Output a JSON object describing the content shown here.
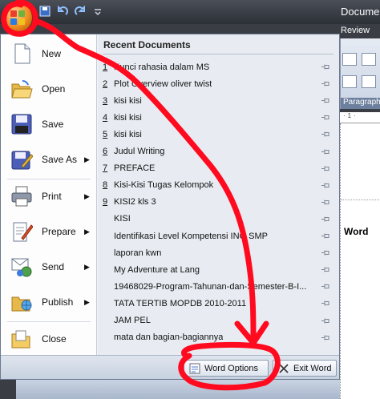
{
  "window": {
    "title": "Docume"
  },
  "ribbon": {
    "tab": "Review",
    "group": "Paragraph",
    "ruler": "·1·"
  },
  "document": {
    "visible_text": "Word"
  },
  "quick_access": [
    {
      "icon": "save-icon"
    },
    {
      "icon": "undo-icon"
    },
    {
      "icon": "redo-icon"
    },
    {
      "icon": "customize-icon"
    }
  ],
  "commands": [
    {
      "label": "New",
      "icon": "new-document-icon",
      "submenu": false
    },
    {
      "label": "Open",
      "icon": "open-folder-icon",
      "submenu": false
    },
    {
      "label": "Save",
      "icon": "save-disk-icon",
      "submenu": false
    },
    {
      "label": "Save As",
      "icon": "save-as-icon",
      "submenu": true
    },
    {
      "label": "Print",
      "icon": "printer-icon",
      "submenu": true
    },
    {
      "label": "Prepare",
      "icon": "prepare-icon",
      "submenu": true
    },
    {
      "label": "Send",
      "icon": "send-icon",
      "submenu": true
    },
    {
      "label": "Publish",
      "icon": "publish-icon",
      "submenu": true
    },
    {
      "label": "Close",
      "icon": "close-folder-icon",
      "submenu": false
    }
  ],
  "recent": {
    "heading": "Recent Documents",
    "items": [
      {
        "num": "1",
        "name": "Kunci rahasia dalam MS"
      },
      {
        "num": "2",
        "name": "Plot Overview oliver twist"
      },
      {
        "num": "3",
        "name": "kisi kisi"
      },
      {
        "num": "4",
        "name": "kisi kisi"
      },
      {
        "num": "5",
        "name": "kisi kisi"
      },
      {
        "num": "6",
        "name": "Judul Writing"
      },
      {
        "num": "7",
        "name": "PREFACE"
      },
      {
        "num": "8",
        "name": "Kisi-Kisi Tugas Kelompok"
      },
      {
        "num": "9",
        "name": "KISI2 kls 3"
      },
      {
        "num": "",
        "name": "KISI"
      },
      {
        "num": "",
        "name": "Identifikasi Level Kompetensi ING SMP"
      },
      {
        "num": "",
        "name": "laporan kwn"
      },
      {
        "num": "",
        "name": "My Adventure at Lang"
      },
      {
        "num": "",
        "name": "19468029-Program-Tahunan-dan-Semester-B-I..."
      },
      {
        "num": "",
        "name": "TATA TERTIB MOPDB 2010-2011"
      },
      {
        "num": "",
        "name": "JAM PEL"
      },
      {
        "num": "",
        "name": "mata dan bagian-bagiannya"
      }
    ]
  },
  "buttons": {
    "word_options": "Word Options",
    "exit_word": "Exit Word"
  },
  "colors": {
    "annotation": "#ff0a1e",
    "orb": "#f08a1e"
  }
}
